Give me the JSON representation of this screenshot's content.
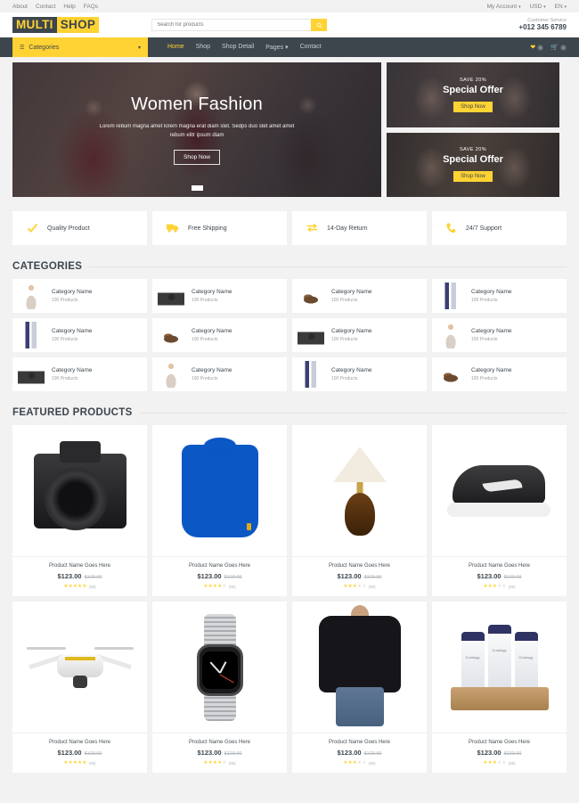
{
  "topbar": {
    "links": [
      "About",
      "Contact",
      "Help",
      "FAQs"
    ],
    "account": "My Account",
    "currency": "USD",
    "language": "EN",
    "caret": "▾"
  },
  "header": {
    "logo_first": "MULTI",
    "logo_second": "SHOP",
    "search_placeholder": "Search for products",
    "search_value": "",
    "search_icon": "search-icon",
    "customer_service_label": "Customer Service",
    "customer_service_phone": "+012 345 6789"
  },
  "nav": {
    "categories_label": "Categories",
    "categories_icon": "bars-icon",
    "links": [
      {
        "label": "Home",
        "active": true
      },
      {
        "label": "Shop",
        "active": false
      },
      {
        "label": "Shop Detail",
        "active": false
      },
      {
        "label": "Pages",
        "active": false,
        "caret": "▾"
      },
      {
        "label": "Contact",
        "active": false
      }
    ],
    "wishlist_count": "0",
    "cart_count": "0"
  },
  "hero": {
    "title": "Women Fashion",
    "description": "Lorem rebum magna amet lorem magna erat diam stet. Sedps duo stet amet amet rebum elitr ipsum diam",
    "button": "Shop Now",
    "offers": [
      {
        "save": "SAVE 20%",
        "title": "Special Offer",
        "button": "Shop Now"
      },
      {
        "save": "SAVE 20%",
        "title": "Special Offer",
        "button": "Shop Now"
      }
    ]
  },
  "features": [
    {
      "icon": "check-icon",
      "label": "Quality Product"
    },
    {
      "icon": "truck-icon",
      "label": "Free Shipping"
    },
    {
      "icon": "exchange-icon",
      "label": "14-Day Return"
    },
    {
      "icon": "phone-icon",
      "label": "24/7 Support"
    }
  ],
  "categories_section": {
    "title": "CATEGORIES",
    "items": [
      {
        "name": "Category Name",
        "count": "100 Products",
        "thumb": "t-woman"
      },
      {
        "name": "Category Name",
        "count": "100 Products",
        "thumb": "t-camera"
      },
      {
        "name": "Category Name",
        "count": "100 Products",
        "thumb": "t-shoe"
      },
      {
        "name": "Category Name",
        "count": "100 Products",
        "thumb": "t-cream"
      },
      {
        "name": "Category Name",
        "count": "100 Products",
        "thumb": "t-cream"
      },
      {
        "name": "Category Name",
        "count": "100 Products",
        "thumb": "t-shoe"
      },
      {
        "name": "Category Name",
        "count": "100 Products",
        "thumb": "t-camera"
      },
      {
        "name": "Category Name",
        "count": "100 Products",
        "thumb": "t-woman"
      },
      {
        "name": "Category Name",
        "count": "100 Products",
        "thumb": "t-camera"
      },
      {
        "name": "Category Name",
        "count": "100 Products",
        "thumb": "t-woman"
      },
      {
        "name": "Category Name",
        "count": "100 Products",
        "thumb": "t-cream"
      },
      {
        "name": "Category Name",
        "count": "100 Products",
        "thumb": "t-shoe"
      }
    ]
  },
  "products_section": {
    "title": "FEATURED PRODUCTS",
    "items": [
      {
        "name": "Product Name Goes Here",
        "price": "$123.00",
        "old_price": "$123.00",
        "stars": 5,
        "reviews": "(99)",
        "art": "camera"
      },
      {
        "name": "Product Name Goes Here",
        "price": "$123.00",
        "old_price": "$123.00",
        "stars": 4,
        "reviews": "(99)",
        "art": "sweater"
      },
      {
        "name": "Product Name Goes Here",
        "price": "$123.00",
        "old_price": "$123.00",
        "stars": 3,
        "reviews": "(99)",
        "art": "lamp"
      },
      {
        "name": "Product Name Goes Here",
        "price": "$123.00",
        "old_price": "$123.00",
        "stars": 3,
        "reviews": "(99)",
        "art": "shoe"
      },
      {
        "name": "Product Name Goes Here",
        "price": "$123.00",
        "old_price": "$123.00",
        "stars": 5,
        "reviews": "(99)",
        "art": "drone"
      },
      {
        "name": "Product Name Goes Here",
        "price": "$123.00",
        "old_price": "$123.00",
        "stars": 4,
        "reviews": "(99)",
        "art": "watch"
      },
      {
        "name": "Product Name Goes Here",
        "price": "$123.00",
        "old_price": "$123.00",
        "stars": 3,
        "reviews": "(99)",
        "art": "blouse"
      },
      {
        "name": "Product Name Goes Here",
        "price": "$123.00",
        "old_price": "$123.00",
        "stars": 3,
        "reviews": "(99)",
        "art": "cream"
      }
    ]
  },
  "colors": {
    "accent": "#ffd333",
    "dark": "#3d464d",
    "page_bg": "#f2f2f2"
  }
}
